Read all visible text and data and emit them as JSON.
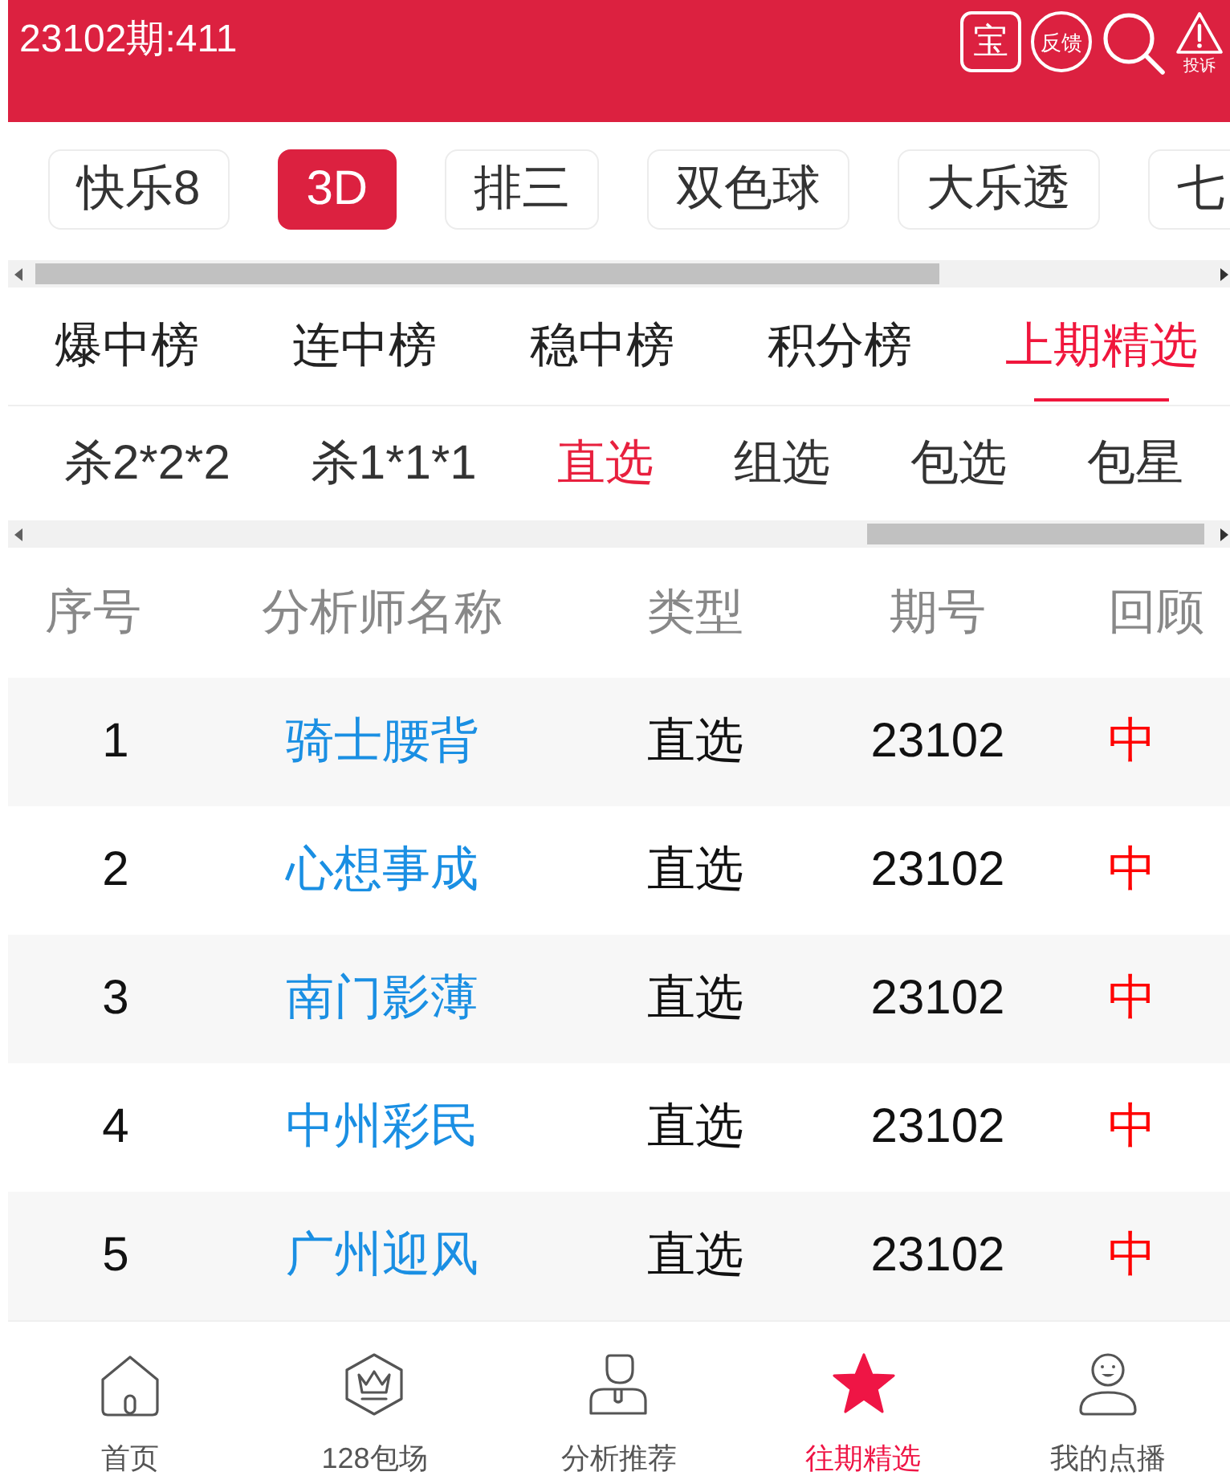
{
  "header": {
    "title": "23102期:411",
    "treasure_button": "宝",
    "feedback_button": "反馈",
    "report_button": "投诉"
  },
  "lottery_tabs": [
    {
      "label": "快乐8",
      "selected": false
    },
    {
      "label": "3D",
      "selected": true
    },
    {
      "label": "排三",
      "selected": false
    },
    {
      "label": "双色球",
      "selected": false
    },
    {
      "label": "大乐透",
      "selected": false
    },
    {
      "label": "七",
      "selected": false
    }
  ],
  "ranking_tabs": [
    {
      "label": "爆中榜",
      "selected": false
    },
    {
      "label": "连中榜",
      "selected": false
    },
    {
      "label": "稳中榜",
      "selected": false
    },
    {
      "label": "积分榜",
      "selected": false
    },
    {
      "label": "上期精选",
      "selected": true
    }
  ],
  "play_tabs": [
    {
      "label": "杀2*2*2",
      "selected": false
    },
    {
      "label": "杀1*1*1",
      "selected": false
    },
    {
      "label": "直选",
      "selected": true
    },
    {
      "label": "组选",
      "selected": false
    },
    {
      "label": "包选",
      "selected": false
    },
    {
      "label": "包星",
      "selected": false
    }
  ],
  "table": {
    "columns": [
      "序号",
      "分析师名称",
      "类型",
      "期号",
      "回顾"
    ],
    "rows": [
      {
        "no": "1",
        "analyst": "骑士腰背",
        "type": "直选",
        "issue": "23102",
        "review": "中"
      },
      {
        "no": "2",
        "analyst": "心想事成",
        "type": "直选",
        "issue": "23102",
        "review": "中"
      },
      {
        "no": "3",
        "analyst": "南门影薄",
        "type": "直选",
        "issue": "23102",
        "review": "中"
      },
      {
        "no": "4",
        "analyst": "中州彩民",
        "type": "直选",
        "issue": "23102",
        "review": "中"
      },
      {
        "no": "5",
        "analyst": "广州迎风",
        "type": "直选",
        "issue": "23102",
        "review": "中"
      }
    ]
  },
  "bottom_nav": [
    {
      "label": "首页",
      "selected": false
    },
    {
      "label": "128包场",
      "selected": false
    },
    {
      "label": "分析推荐",
      "selected": false
    },
    {
      "label": "往期精选",
      "selected": true
    },
    {
      "label": "我的点播",
      "selected": false
    }
  ]
}
